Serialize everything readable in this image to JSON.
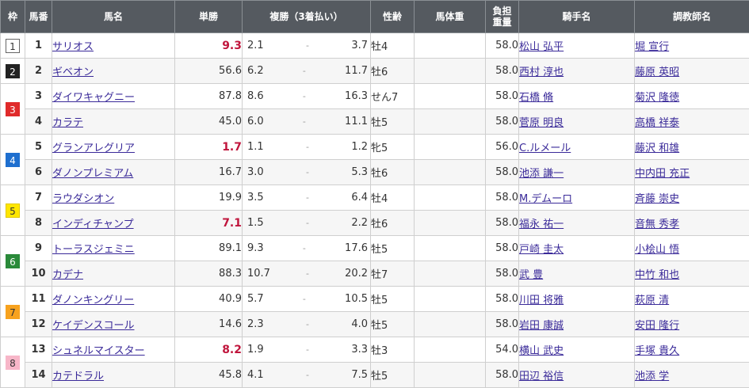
{
  "headers": {
    "waku": "枠",
    "umaban": "馬番",
    "horse": "馬名",
    "win": "単勝",
    "place": "複勝（3着払い）",
    "sexage": "性齢",
    "bodyweight": "馬体重",
    "burden_l1": "負担",
    "burden_l2": "重量",
    "jockey": "騎手名",
    "trainer": "調教師名"
  },
  "waku_colors": {
    "1": {
      "bg": "#ffffff",
      "fg": "#333333",
      "border": "#666666"
    },
    "2": {
      "bg": "#222222",
      "fg": "#ffffff",
      "border": "#222222"
    },
    "3": {
      "bg": "#e02a2a",
      "fg": "#ffffff",
      "border": "#e02a2a"
    },
    "4": {
      "bg": "#1e6fcf",
      "fg": "#ffffff",
      "border": "#1e6fcf"
    },
    "5": {
      "bg": "#ffe600",
      "fg": "#333333",
      "border": "#e0c800"
    },
    "6": {
      "bg": "#2a8a3a",
      "fg": "#ffffff",
      "border": "#2a8a3a"
    },
    "7": {
      "bg": "#f7a21e",
      "fg": "#333333",
      "border": "#f7a21e"
    },
    "8": {
      "bg": "#f7b6c8",
      "fg": "#333333",
      "border": "#f7b6c8"
    }
  },
  "rows": [
    {
      "waku": "1",
      "num": "1",
      "horse": "サリオス",
      "win": "9.3",
      "fav": true,
      "pmin": "2.1",
      "pmax": "3.7",
      "sex": "牡4",
      "weight": "58.0",
      "jockey": "松山 弘平",
      "trainer": "堀 宣行"
    },
    {
      "waku": "2",
      "num": "2",
      "horse": "ギベオン",
      "win": "56.6",
      "fav": false,
      "pmin": "6.2",
      "pmax": "11.7",
      "sex": "牡6",
      "weight": "58.0",
      "jockey": "西村 淳也",
      "trainer": "藤原 英昭"
    },
    {
      "waku": "3",
      "num": "3",
      "horse": "ダイワキャグニー",
      "win": "87.8",
      "fav": false,
      "pmin": "8.6",
      "pmax": "16.3",
      "sex": "せん7",
      "weight": "58.0",
      "jockey": "石橋 脩",
      "trainer": "菊沢 隆徳"
    },
    {
      "waku": "3",
      "num": "4",
      "horse": "カラテ",
      "win": "45.0",
      "fav": false,
      "pmin": "6.0",
      "pmax": "11.1",
      "sex": "牡5",
      "weight": "58.0",
      "jockey": "菅原 明良",
      "trainer": "高橋 祥泰"
    },
    {
      "waku": "4",
      "num": "5",
      "horse": "グランアレグリア",
      "win": "1.7",
      "fav": true,
      "pmin": "1.1",
      "pmax": "1.2",
      "sex": "牝5",
      "weight": "56.0",
      "jockey": "C.ルメール",
      "trainer": "藤沢 和雄"
    },
    {
      "waku": "4",
      "num": "6",
      "horse": "ダノンプレミアム",
      "win": "16.7",
      "fav": false,
      "pmin": "3.0",
      "pmax": "5.3",
      "sex": "牡6",
      "weight": "58.0",
      "jockey": "池添 謙一",
      "trainer": "中内田 充正"
    },
    {
      "waku": "5",
      "num": "7",
      "horse": "ラウダシオン",
      "win": "19.9",
      "fav": false,
      "pmin": "3.5",
      "pmax": "6.4",
      "sex": "牡4",
      "weight": "58.0",
      "jockey": "M.デムーロ",
      "trainer": "斉藤 崇史"
    },
    {
      "waku": "5",
      "num": "8",
      "horse": "インディチャンプ",
      "win": "7.1",
      "fav": true,
      "pmin": "1.5",
      "pmax": "2.2",
      "sex": "牡6",
      "weight": "58.0",
      "jockey": "福永 祐一",
      "trainer": "音無 秀孝"
    },
    {
      "waku": "6",
      "num": "9",
      "horse": "トーラスジェミニ",
      "win": "89.1",
      "fav": false,
      "pmin": "9.3",
      "pmax": "17.6",
      "sex": "牡5",
      "weight": "58.0",
      "jockey": "戸崎 圭太",
      "trainer": "小桧山 悟"
    },
    {
      "waku": "6",
      "num": "10",
      "horse": "カデナ",
      "win": "88.3",
      "fav": false,
      "pmin": "10.7",
      "pmax": "20.2",
      "sex": "牡7",
      "weight": "58.0",
      "jockey": "武 豊",
      "trainer": "中竹 和也"
    },
    {
      "waku": "7",
      "num": "11",
      "horse": "ダノンキングリー",
      "win": "40.9",
      "fav": false,
      "pmin": "5.7",
      "pmax": "10.5",
      "sex": "牡5",
      "weight": "58.0",
      "jockey": "川田 将雅",
      "trainer": "萩原 清"
    },
    {
      "waku": "7",
      "num": "12",
      "horse": "ケイデンスコール",
      "win": "14.6",
      "fav": false,
      "pmin": "2.3",
      "pmax": "4.0",
      "sex": "牡5",
      "weight": "58.0",
      "jockey": "岩田 康誠",
      "trainer": "安田 隆行"
    },
    {
      "waku": "8",
      "num": "13",
      "horse": "シュネルマイスター",
      "win": "8.2",
      "fav": true,
      "pmin": "1.9",
      "pmax": "3.3",
      "sex": "牡3",
      "weight": "54.0",
      "jockey": "横山 武史",
      "trainer": "手塚 貴久"
    },
    {
      "waku": "8",
      "num": "14",
      "horse": "カテドラル",
      "win": "45.8",
      "fav": false,
      "pmin": "4.1",
      "pmax": "7.5",
      "sex": "牡5",
      "weight": "58.0",
      "jockey": "田辺 裕信",
      "trainer": "池添 学"
    }
  ],
  "place_separator": "-"
}
